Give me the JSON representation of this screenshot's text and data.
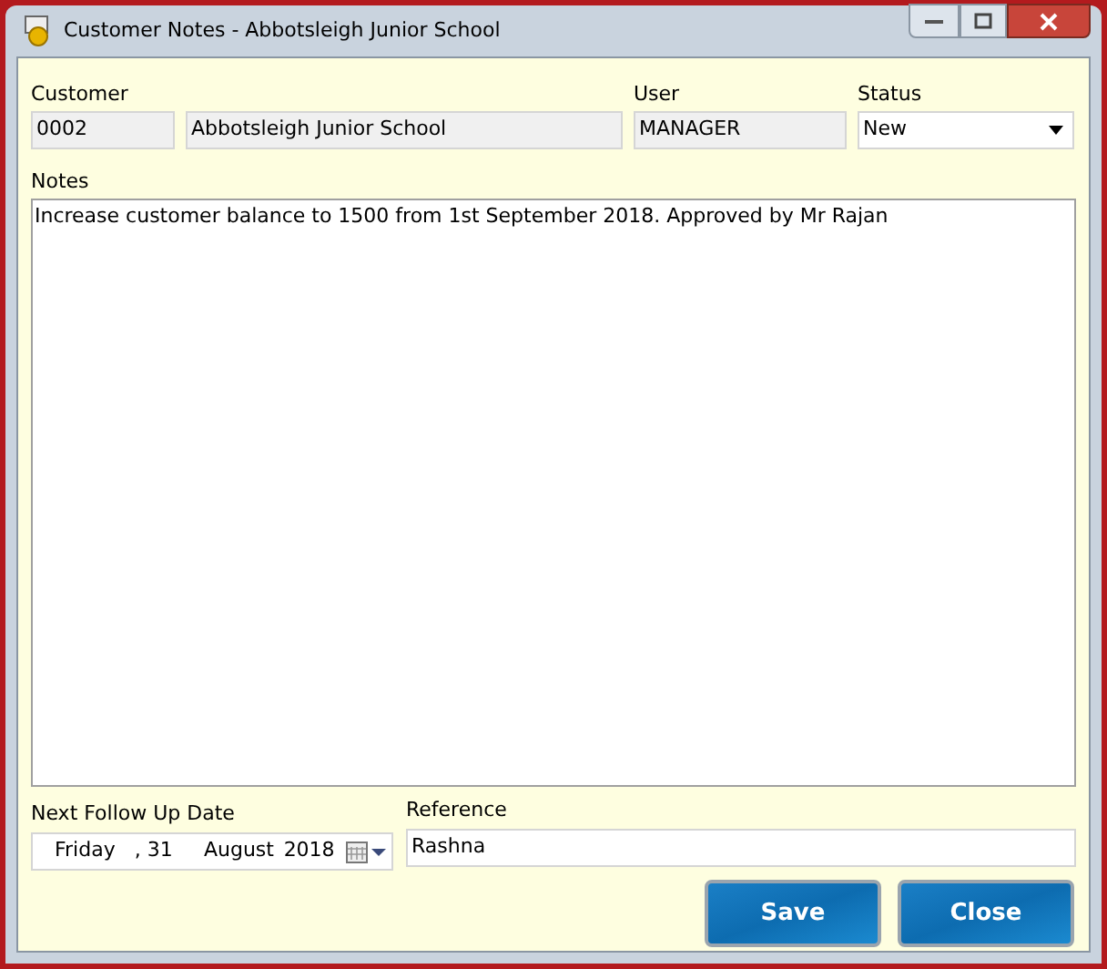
{
  "window": {
    "title": "Customer Notes - Abbotsleigh Junior School"
  },
  "customer": {
    "label": "Customer",
    "code": "0002",
    "name": "Abbotsleigh Junior School"
  },
  "user": {
    "label": "User",
    "value": "MANAGER"
  },
  "status": {
    "label": "Status",
    "value": "New"
  },
  "notes": {
    "label": "Notes",
    "value": "Increase customer balance to 1500 from 1st September 2018. Approved by Mr Rajan"
  },
  "follow_up": {
    "label": "Next Follow Up Date",
    "parts": [
      "Friday",
      ", 31",
      "August",
      "2018"
    ]
  },
  "reference": {
    "label": "Reference",
    "value": "Rashna"
  },
  "buttons": [
    "Save",
    "Close"
  ]
}
